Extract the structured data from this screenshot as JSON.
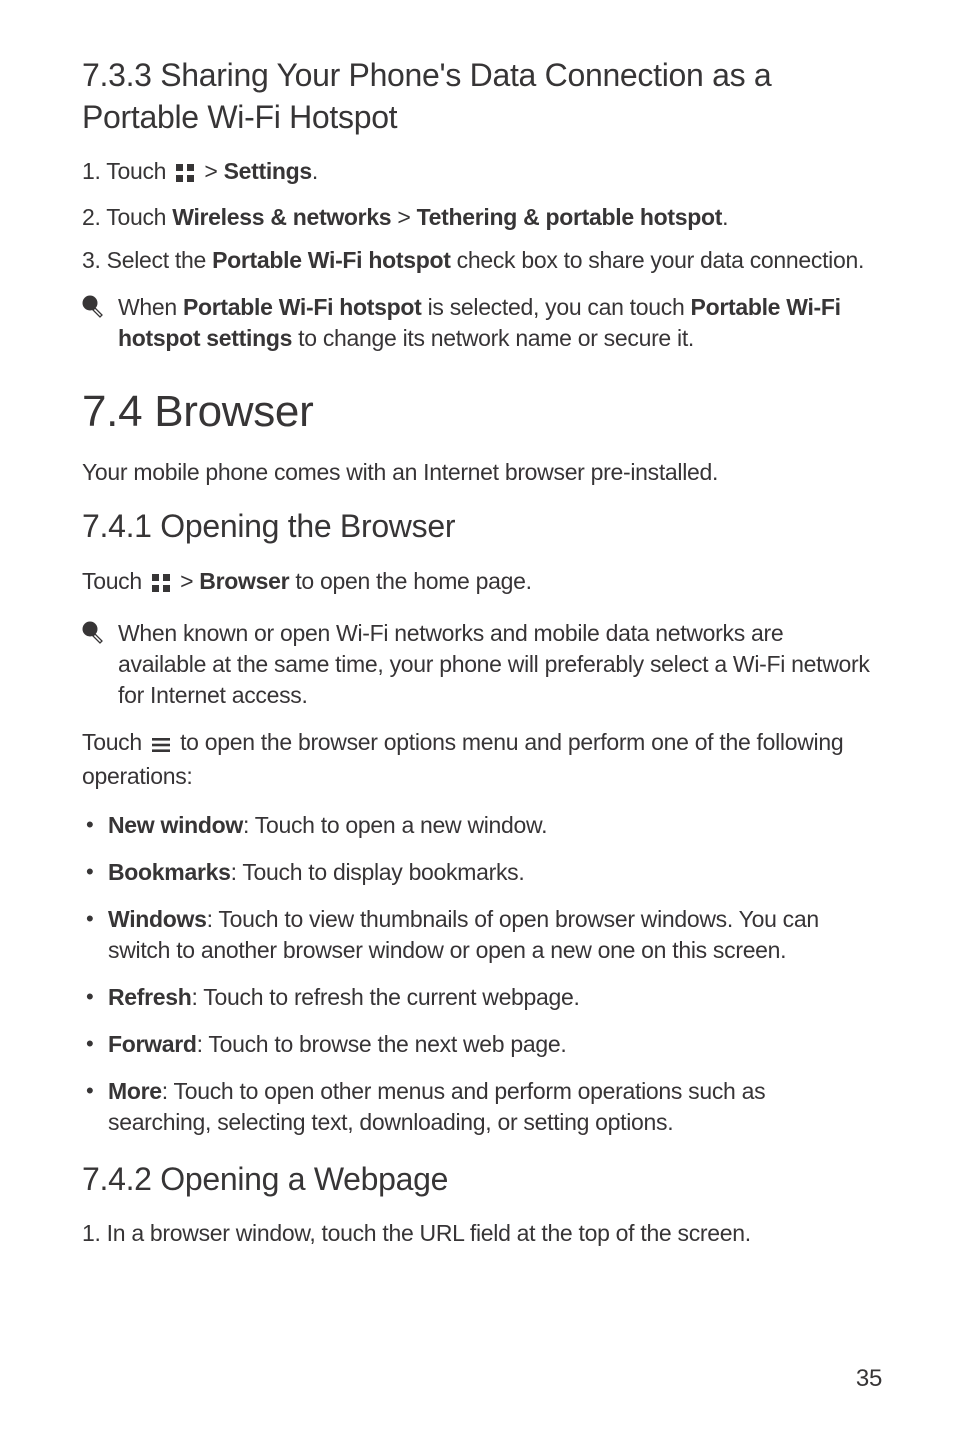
{
  "section733": {
    "heading": "7.3.3  Sharing Your Phone's Data Connection as a Portable Wi-Fi Hotspot",
    "step1_a": "1. Touch ",
    "step1_b": " > ",
    "step1_settings": "Settings",
    "step1_c": ".",
    "step2_a": "2. Touch ",
    "step2_wn": "Wireless & networks",
    "step2_gt": " > ",
    "step2_tph": "Tethering & portable hotspot",
    "step2_c": ".",
    "step3_a": "3. Select the ",
    "step3_pwh": "Portable Wi-Fi hotspot",
    "step3_b": " check box to share your data connection.",
    "note_a": "When ",
    "note_pwh": "Portable Wi-Fi hotspot",
    "note_b": " is selected, you can touch ",
    "note_pwhs": "Portable Wi-Fi hotspot settings",
    "note_c": " to change its network name or secure it."
  },
  "section74": {
    "heading": "7.4  Browser",
    "intro": "Your mobile phone comes with an Internet browser pre-installed."
  },
  "section741": {
    "heading": "7.4.1  Opening the Browser",
    "touch_a": "Touch ",
    "touch_b": " > ",
    "touch_browser": "Browser",
    "touch_c": " to open the home page.",
    "note": "When known or open Wi-Fi networks and mobile data networks are available at the same time, your phone will preferably select a Wi-Fi network for Internet access.",
    "menu_a": "Touch ",
    "menu_b": " to open the browser options menu and perform one of the following operations:",
    "items": [
      {
        "label": "New window",
        "desc": ": Touch to open a new window."
      },
      {
        "label": "Bookmarks",
        "desc": ": Touch to display bookmarks."
      },
      {
        "label": "Windows",
        "desc": ": Touch to view thumbnails of open browser windows. You can switch to another browser window or open a new one on this screen."
      },
      {
        "label": "Refresh",
        "desc": ": Touch to refresh the current webpage."
      },
      {
        "label": "Forward",
        "desc": ": Touch to browse the next web page."
      },
      {
        "label": "More",
        "desc": ": Touch to open other menus and perform operations such as searching, selecting text, downloading, or setting options."
      }
    ]
  },
  "section742": {
    "heading": "7.4.2  Opening a Webpage",
    "step1": "1. In a browser window, touch the URL field at the top of the screen."
  },
  "page_number": "35"
}
